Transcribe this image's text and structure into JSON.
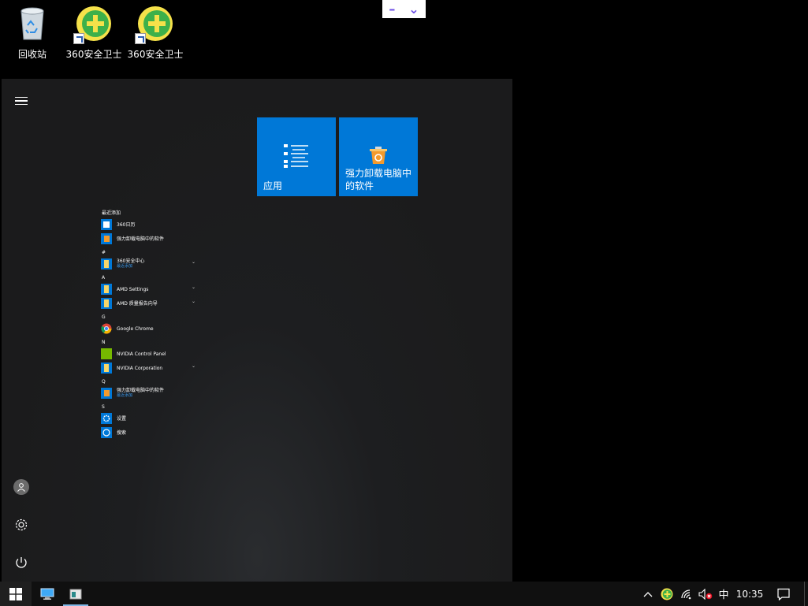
{
  "desktop": {
    "icons": [
      {
        "label": "回收站",
        "icon": "recycle-bin-icon"
      },
      {
        "label": "360安全卫士",
        "icon": "360-safe-icon"
      },
      {
        "label": "360安全卫士",
        "icon": "360-safe-icon"
      }
    ]
  },
  "widget": {
    "minimize": "–",
    "expand": "⌄"
  },
  "start": {
    "tiles": [
      {
        "label": "应用",
        "icon": "list-icon"
      },
      {
        "label": "强力卸载电脑中的软件",
        "icon": "uninstall-box-icon"
      }
    ],
    "sections": [
      {
        "header": "最近添加",
        "items": [
          {
            "name": "360日历",
            "icon": "calendar-icon"
          },
          {
            "name": "强力卸载电脑中的软件",
            "icon": "uninstall-icon"
          }
        ]
      },
      {
        "header": "#",
        "items": [
          {
            "name": "360安全中心",
            "sub": "最近添加",
            "icon": "folder-icon",
            "expandable": true
          }
        ]
      },
      {
        "header": "A",
        "items": [
          {
            "name": "AMD Settings",
            "icon": "folder-icon",
            "expandable": true
          },
          {
            "name": "AMD 质量报告向导",
            "icon": "folder-icon",
            "expandable": true
          }
        ]
      },
      {
        "header": "G",
        "items": [
          {
            "name": "Google Chrome",
            "icon": "chrome-icon"
          }
        ]
      },
      {
        "header": "N",
        "items": [
          {
            "name": "NVIDIA Control Panel",
            "icon": "nvidia-icon"
          },
          {
            "name": "NVIDIA Corporation",
            "icon": "folder-icon",
            "expandable": true
          }
        ]
      },
      {
        "header": "Q",
        "items": [
          {
            "name": "强力卸载电脑中的软件",
            "sub": "最近添加",
            "icon": "uninstall-icon"
          }
        ]
      },
      {
        "header": "S",
        "items": [
          {
            "name": "设置",
            "icon": "gear-icon"
          },
          {
            "name": "搜索",
            "icon": "search-icon"
          }
        ]
      }
    ]
  },
  "taskbar": {
    "clock": "10:35",
    "ime": "中"
  }
}
